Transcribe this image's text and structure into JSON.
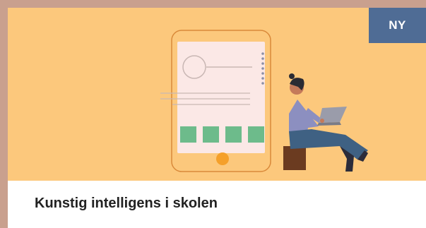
{
  "card": {
    "badge": "NY",
    "title": "Kunstig intelligens i skolen"
  },
  "colors": {
    "background": "#c9a08e",
    "illustration_bg": "#fcc87c",
    "badge_bg": "#4f6c95",
    "card_bg": "#ffffff",
    "title_text": "#222222"
  },
  "icons": [
    "tablet-illustration",
    "person-with-laptop-illustration"
  ]
}
